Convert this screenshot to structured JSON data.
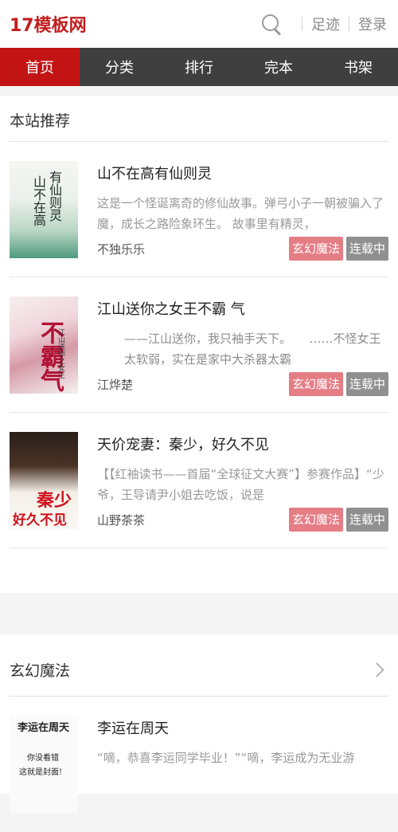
{
  "header": {
    "logo": "17模板网",
    "footprint": "足迹",
    "login": "登录"
  },
  "nav": [
    "首页",
    "分类",
    "排行",
    "完本",
    "书架"
  ],
  "recommend": {
    "title": "本站推荐",
    "books": [
      {
        "title": "山不在高有仙则灵",
        "desc": "这是一个怪诞离奇的修仙故事。弹弓小子一朝被骗入了魔，成长之路险象环生。 故事里有精灵，",
        "author": "不独乐乐",
        "genre": "玄幻魔法",
        "status": "连载中",
        "cover_text": [
          "有仙则灵",
          "山不在高"
        ]
      },
      {
        "title": "江山送你之女王不霸 气",
        "desc": "——江山送你，我只袖手天下。　　……不怪女王太软弱，实在是家中大杀器太霸",
        "author": "江烨楚",
        "genre": "玄幻魔法",
        "status": "连载中",
        "cover_text": [
          "不霸气",
          "江山送你之女王"
        ]
      },
      {
        "title": "天价宠妻：秦少，好久不见",
        "desc": "【【红袖读书——首届“全球征文大赛”】参赛作品】“少爷，王导请尹小姐去吃饭，说是",
        "author": "山野茶茶",
        "genre": "玄幻魔法",
        "status": "连载中",
        "cover_text": [
          "秦少",
          "好久不见"
        ]
      }
    ]
  },
  "fantasy": {
    "title": "玄幻魔法",
    "books": [
      {
        "title": "李运在周天",
        "desc": "“嘀，恭喜李运同学毕业！”“嘀，李运成为无业游",
        "cover_text": [
          "李运在周天",
          "你没看错",
          "这就是封面!"
        ]
      }
    ]
  },
  "colors": {
    "brand": "#c21d1d",
    "nav_bg": "#3f3f3f",
    "nav_active": "#c21414",
    "genre_tag": "#e57d85",
    "status_tag": "#909090"
  }
}
